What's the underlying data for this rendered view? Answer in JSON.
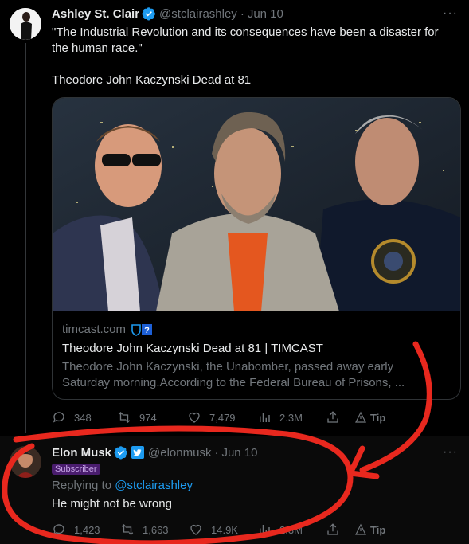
{
  "tweet1": {
    "author_name": "Ashley St. Clair",
    "handle": "@stclairashley",
    "separator": "·",
    "date": "Jun 10",
    "more": "···",
    "text_line1": "\"The Industrial Revolution and its consequences have been a disaster for",
    "text_line2": "the human race.\"",
    "text_line3": "Theodore John Kaczynski Dead at 81",
    "card": {
      "domain": "timcast.com",
      "title": "Theodore John Kaczynski Dead at 81 | TIMCAST",
      "desc_line1": "Theodore John Kaczynski, the Unabomber, passed away early",
      "desc_line2": "Saturday morning.According to the Federal Bureau of Prisons, ..."
    },
    "actions": {
      "replies": "348",
      "retweets": "974",
      "likes": "7,479",
      "views": "2.3M",
      "tip": "Tip"
    }
  },
  "tweet2": {
    "author_name": "Elon Musk",
    "handle": "@elonmusk",
    "separator": "·",
    "date": "Jun 10",
    "more": "···",
    "badge": "Subscriber",
    "replying_prefix": "Replying to",
    "replying_handle": "@stclairashley",
    "text": "He might not be wrong",
    "actions": {
      "replies": "1,423",
      "retweets": "1,663",
      "likes": "14.9K",
      "views": "2.3M",
      "tip": "Tip"
    }
  },
  "colors": {
    "accent": "#1d9bf0",
    "muted": "#71767b",
    "annotation": "#e8281e",
    "badge": "#4a1d6e"
  }
}
